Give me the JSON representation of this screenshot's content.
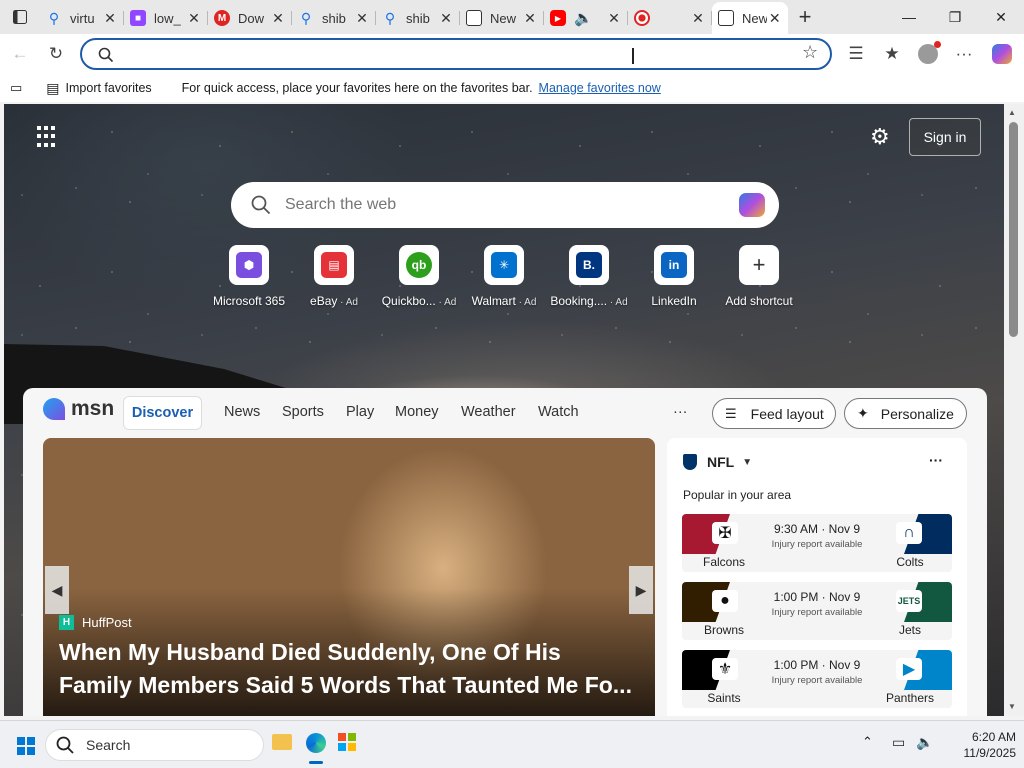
{
  "tabs": [
    {
      "label": "virtu",
      "fav": "search",
      "color": "#1a73e8"
    },
    {
      "label": "low_",
      "fav": "twitch",
      "color": "#9146ff"
    },
    {
      "label": "Dow",
      "fav": "M",
      "color": "#e02424"
    },
    {
      "label": "shib",
      "fav": "search",
      "color": "#1a73e8"
    },
    {
      "label": "shib",
      "fav": "search",
      "color": "#1a73e8"
    },
    {
      "label": "New",
      "fav": "newtab",
      "color": "#333"
    },
    {
      "label": "",
      "fav": "youtube",
      "color": "#ff0000"
    },
    {
      "label": "",
      "fav": "recording",
      "color": "#e02424"
    },
    {
      "label": "New",
      "fav": "newtab",
      "color": "#333"
    }
  ],
  "address": {
    "value": "",
    "placeholder": ""
  },
  "favorites_bar": {
    "import_label": "Import favorites",
    "message": "For quick access, place your favorites here on the favorites bar.",
    "manage_link": "Manage favorites now"
  },
  "header": {
    "sign_in": "Sign in"
  },
  "search": {
    "placeholder": "Search the web"
  },
  "shortcuts": [
    {
      "label": "Microsoft 365",
      "ad": "",
      "icon": "m365-icon",
      "color": "#7a4fe0"
    },
    {
      "label": "eBay",
      "ad": "Ad",
      "icon": "ebay-icon",
      "color": "#e53238"
    },
    {
      "label": "Quickbo...",
      "ad": "Ad",
      "icon": "quickbooks-icon",
      "color": "#2ca01c"
    },
    {
      "label": "Walmart",
      "ad": "Ad",
      "icon": "walmart-icon",
      "color": "#0071ce"
    },
    {
      "label": "Booking....",
      "ad": "Ad",
      "icon": "booking-icon",
      "color": "#003580"
    },
    {
      "label": "LinkedIn",
      "ad": "",
      "icon": "linkedin-icon",
      "color": "#0a66c2"
    },
    {
      "label": "Add shortcut",
      "ad": "",
      "icon": "plus-icon",
      "color": "#333"
    }
  ],
  "msn": {
    "brand": "msn",
    "nav": [
      "Discover",
      "News",
      "Sports",
      "Play",
      "Money",
      "Weather",
      "Watch"
    ],
    "more": "···",
    "feed_layout": "Feed layout",
    "personalize": "Personalize"
  },
  "hero": {
    "source": "HuffPost",
    "headline_line1": "When My Husband Died Suddenly, One Of His",
    "headline_line2": "Family Members Said 5 Words That Taunted Me Fo..."
  },
  "nfl": {
    "title": "NFL",
    "subtitle": "Popular in your area",
    "games": [
      {
        "team1": "Falcons",
        "team2": "Colts",
        "time": "9:30 AM · Nov 9",
        "note": "Injury report available",
        "c1": "#a71930",
        "c2": "#002c5f",
        "logo1": "✠",
        "logo2": "∩"
      },
      {
        "team1": "Browns",
        "team2": "Jets",
        "time": "1:00 PM · Nov 9",
        "note": "Injury report available",
        "c1": "#311d00",
        "c2": "#125740",
        "logo1": "●",
        "logo2": "JETS"
      },
      {
        "team1": "Saints",
        "team2": "Panthers",
        "time": "1:00 PM · Nov 9",
        "note": "Injury report available",
        "c1": "#000000",
        "c2": "#0085ca",
        "logo1": "⚜",
        "logo2": "▶"
      }
    ]
  },
  "taskbar": {
    "search_label": "Search",
    "time": "6:20 AM",
    "date": "11/9/2025"
  }
}
